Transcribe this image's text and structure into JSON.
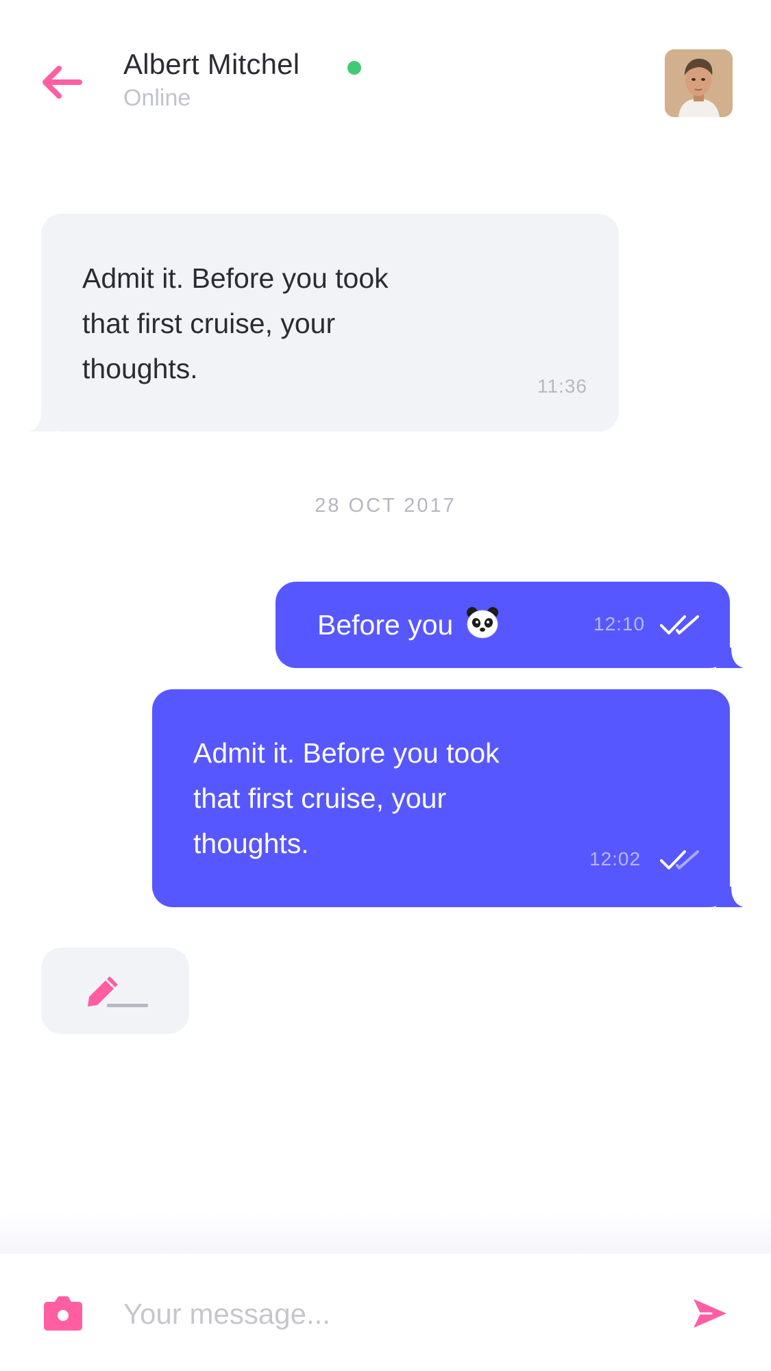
{
  "header": {
    "contact_name": "Albert Mitchel",
    "contact_status": "Online",
    "icons": {
      "back": "arrow-left-icon",
      "avatar": "avatar"
    }
  },
  "messages": [
    {
      "direction": "incoming",
      "lines": [
        "Admit it. Before you took",
        "that first cruise, your",
        "thoughts."
      ],
      "time": "11:36"
    },
    {
      "direction": "outgoing",
      "text": "Before you",
      "emoji_icon": "panda-emoji-icon",
      "time": "12:10",
      "receipt": "double-check-icon"
    },
    {
      "direction": "outgoing",
      "lines": [
        "Admit it. Before you took",
        "that first cruise, your",
        "thoughts."
      ],
      "time": "12:02",
      "receipt": "double-check-icon"
    }
  ],
  "date_separator": "28 OCT 2017",
  "typing_indicator": {
    "icon": "pencil-icon"
  },
  "composer": {
    "placeholder": "Your message...",
    "value": "",
    "icons": {
      "camera": "camera-icon",
      "send": "send-icon"
    }
  },
  "colors": {
    "accent_pink": "#ff5fa2",
    "outgoing_bubble": "#5757ff",
    "incoming_bubble": "#f2f3f7",
    "online_dot": "#3ecb73"
  }
}
